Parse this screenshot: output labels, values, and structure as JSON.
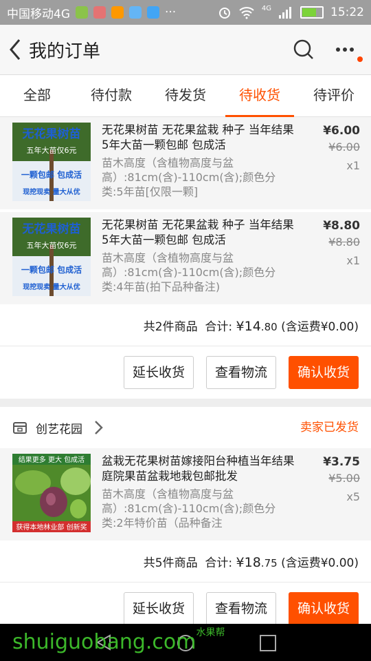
{
  "statusbar": {
    "carrier": "中国移动4G",
    "network": "4G",
    "time": "15:22",
    "battery_level": 0.75
  },
  "header": {
    "title": "我的订单"
  },
  "tabs": [
    {
      "label": "全部"
    },
    {
      "label": "待付款"
    },
    {
      "label": "待发货"
    },
    {
      "label": "待收货",
      "active": true
    },
    {
      "label": "待评价"
    }
  ],
  "orders": [
    {
      "items": [
        {
          "title": "无花果树苗 无花果盆栽 种子 当年结果5年大苗一颗包邮 包成活",
          "spec": "苗木高度（含植物高度与盆高）:81cm(含)-110cm(含);颜色分类:5年苗[仅限一颗]",
          "price": "¥6.00",
          "old_price": "¥6.00",
          "qty": "x1",
          "thumb_text": [
            "无花果树苗",
            "五年大苗仅6元",
            "一颗包邮 包成活",
            "现挖现卖 量大从优"
          ]
        },
        {
          "title": "无花果树苗 无花果盆栽 种子 当年结果5年大苗一颗包邮 包成活",
          "spec": "苗木高度（含植物高度与盆高）:81cm(含)-110cm(含);颜色分类:4年苗(拍下品种备注)",
          "price": "¥8.80",
          "old_price": "¥8.80",
          "qty": "x1",
          "thumb_text": [
            "无花果树苗",
            "五年大苗仅6元",
            "一颗包邮 包成活",
            "现挖现卖 量大从优"
          ]
        }
      ],
      "summary": {
        "count": "共2件商品",
        "total_label": "合计:",
        "total_main": "¥14",
        "total_cents": ".80",
        "shipping": "(含运费¥0.00)"
      },
      "actions": {
        "extend": "延长收货",
        "logistics": "查看物流",
        "confirm": "确认收货"
      }
    },
    {
      "shop": {
        "name": "创艺花园",
        "status": "卖家已发货"
      },
      "items": [
        {
          "title": "盆栽无花果树苗嫁接阳台种植当年结果庭院果苗盆栽地栽包邮批发",
          "spec": "苗木高度（含植物高度与盆高）:81cm(含)-110cm(含);颜色分类:2年特价苗（品种备注",
          "price": "¥3.75",
          "old_price": "¥5.00",
          "qty": "x5",
          "thumb_text": [
            "结果更多 更大 包成活",
            "获得本地林业部 创新奖"
          ]
        }
      ],
      "summary": {
        "count": "共5件商品",
        "total_label": "合计:",
        "total_main": "¥18",
        "total_cents": ".75",
        "shipping": "(含运费¥0.00)"
      },
      "actions": {
        "extend": "延长收货",
        "logistics": "查看物流",
        "confirm": "确认收货"
      }
    }
  ],
  "watermark": {
    "text": "shuiguobang.com",
    "cn": "水果帮"
  },
  "colors": {
    "accent": "#ff5000",
    "statusbar": "#9e9e9e"
  },
  "icons": [
    "back-icon",
    "search-icon",
    "more-icon",
    "shop-icon",
    "chevron-right-icon"
  ]
}
